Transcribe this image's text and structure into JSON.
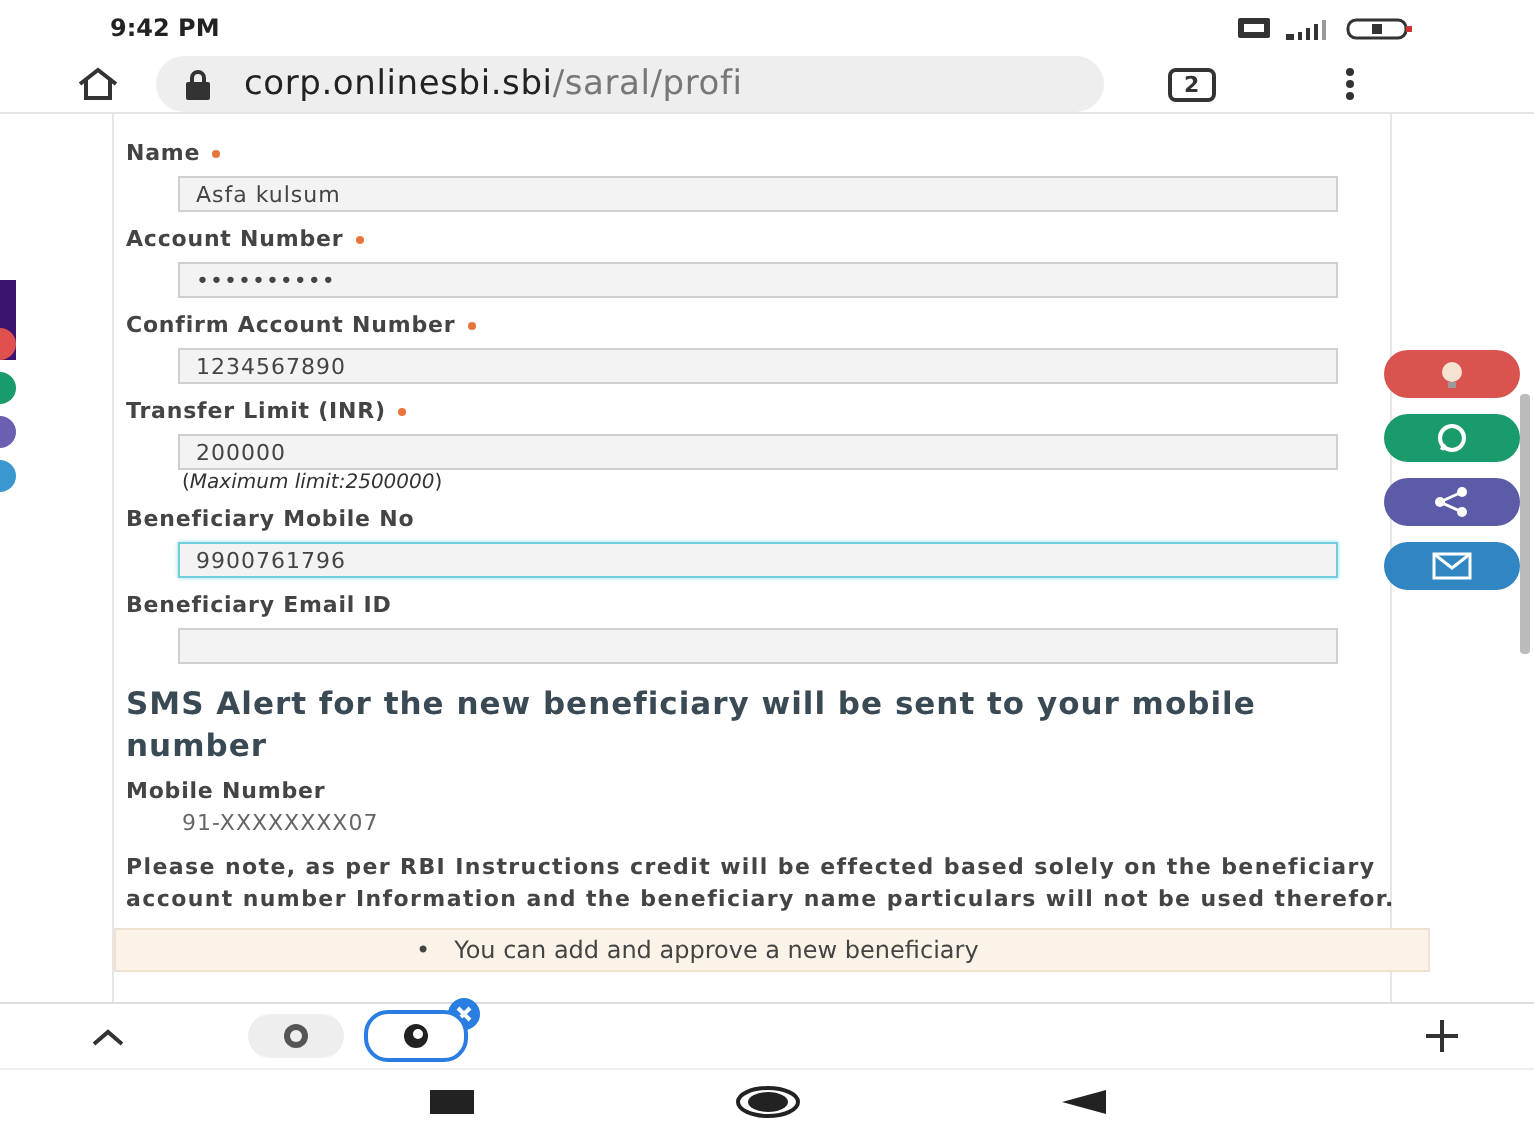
{
  "status_bar": {
    "time": "9:42 PM"
  },
  "browser": {
    "url_host": "corp.onlinesbi.sbi",
    "url_path": "/saral/profi",
    "tab_count": "2"
  },
  "form": {
    "fields": [
      {
        "label": "Name",
        "required": true,
        "value": "Asfa kulsum",
        "focused": false
      },
      {
        "label": "Account Number",
        "required": true,
        "value": "••••••••••",
        "focused": false
      },
      {
        "label": "Confirm Account Number",
        "required": true,
        "value": "1234567890",
        "focused": false
      },
      {
        "label": "Transfer Limit (INR)",
        "required": true,
        "value": "200000",
        "focused": false,
        "hint": "(*Maximum limit:2500000*)"
      },
      {
        "label": "Beneficiary Mobile No",
        "required": false,
        "value": "9900761796",
        "focused": true
      },
      {
        "label": "Beneficiary Email ID",
        "required": false,
        "focused": false
      }
    ]
  },
  "sms_alert": {
    "heading": "SMS Alert for the new beneficiary will be sent to your mobile number",
    "mobile_label": "Mobile Number",
    "mobile_value": "91-XXXXXXXX07"
  },
  "note": "Please note, as per RBI Instructions credit will be effected based solely on the beneficiary account number Information and the beneficiary name particulars will not be used therefor.",
  "info_box": {
    "items": [
      {
        "marker": "•",
        "text": "You can add and approve a new beneficiary"
      }
    ]
  },
  "floating_buttons": [
    {
      "kind": "bulb",
      "color": "#d9534f"
    },
    {
      "kind": "whatsapp",
      "color": "#1a9b6c"
    },
    {
      "kind": "share",
      "color": "#5b5ba8"
    },
    {
      "kind": "mail",
      "color": "#2f86c2"
    }
  ]
}
